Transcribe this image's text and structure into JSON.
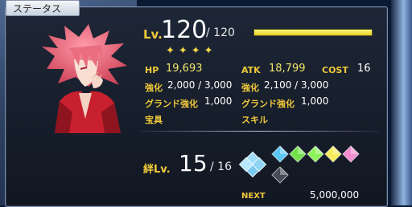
{
  "panel": {
    "title": "ステータス"
  },
  "level": {
    "label": "Lv.",
    "current": "120",
    "max": "/ 120",
    "fill_fraction": 1.0
  },
  "rarity_stars": "✦✦✦✦",
  "stats": {
    "hp_label": "HP",
    "hp_value": "19,693",
    "atk_label": "ATK",
    "atk_value": "18,799",
    "cost_label": "COST",
    "cost_value": "16",
    "hp_fou_label": "強化",
    "hp_fou_value": "2,000 / 3,000",
    "atk_fou_label": "強化",
    "atk_fou_value": "2,100 / 3,000",
    "hp_grand_label": "グランド強化",
    "hp_grand_value": "1,000",
    "atk_grand_label": "グランド強化",
    "atk_grand_value": "1,000",
    "np_label": "宝具",
    "skill_label": "スキル"
  },
  "bond": {
    "label": "絆Lv.",
    "current": "15",
    "max": "/ 16",
    "next_label": "NEXT",
    "next_value": "5,000,000",
    "gem_colors": [
      "#5cc6f5",
      "#2f6fd8",
      "#73e04a",
      "#8ef25a",
      "#f5ec5c",
      "#f28ccf",
      "#444c57"
    ]
  },
  "colors": {
    "gold": "#f0c93a",
    "panel": "#161d2a"
  }
}
